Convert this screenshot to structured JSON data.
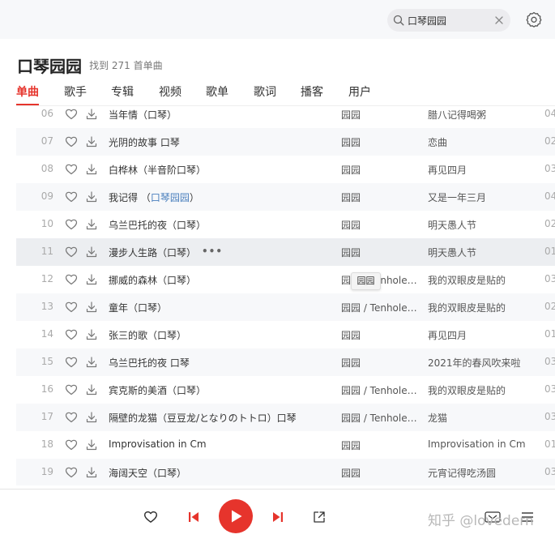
{
  "search": {
    "value": "口琴园园"
  },
  "header": {
    "title": "口琴园园",
    "found_text": "找到 271 首单曲"
  },
  "tabs": [
    {
      "label": "单曲"
    },
    {
      "label": "歌手"
    },
    {
      "label": "专辑"
    },
    {
      "label": "视频"
    },
    {
      "label": "歌单"
    },
    {
      "label": "歌词"
    },
    {
      "label": "播客"
    },
    {
      "label": "用户"
    }
  ],
  "songs": [
    {
      "num": "06",
      "name": "当年情（口琴）",
      "artist": "园园",
      "album": "腊八记得喝粥",
      "dur": "04"
    },
    {
      "num": "07",
      "name": "光阴的故事 口琴",
      "artist": "园园",
      "album": "恋曲",
      "dur": "02"
    },
    {
      "num": "08",
      "name": "白桦林（半音阶口琴）",
      "artist": "园园",
      "album": "再见四月",
      "dur": "03"
    },
    {
      "num": "09",
      "name_pre": "我记得 （",
      "name_hl": "口琴园园",
      "name_post": "）",
      "artist": "园园",
      "album": "又是一年三月",
      "dur": "04"
    },
    {
      "num": "10",
      "name": "乌兰巴托的夜（口琴）",
      "artist": "园园",
      "album": "明天愚人节",
      "dur": "02"
    },
    {
      "num": "11",
      "name": "漫步人生路（口琴）",
      "more": "•••",
      "artist": "园园",
      "album": "明天愚人节",
      "dur": "01"
    },
    {
      "num": "12",
      "name": "挪威的森林（口琴）",
      "artist": "园园 / Tenholes...",
      "album": "我的双眼皮是贴的",
      "dur": "03"
    },
    {
      "num": "13",
      "name": "童年（口琴）",
      "artist": "园园 / Tenholes...",
      "album": "我的双眼皮是贴的",
      "dur": "02"
    },
    {
      "num": "14",
      "name": "张三的歌（口琴）",
      "artist": "园园",
      "album": "再见四月",
      "dur": "01"
    },
    {
      "num": "15",
      "name": "乌兰巴托的夜 口琴",
      "artist": "园园",
      "album": "2021年的春风吹来啦",
      "dur": "03"
    },
    {
      "num": "16",
      "name": "宾克斯的美酒（口琴）",
      "artist": "园园 / Tenholes...",
      "album": "我的双眼皮是贴的",
      "dur": "03"
    },
    {
      "num": "17",
      "name": "隔壁的龙猫（豆豆龙/となりのトトロ）口琴",
      "artist": "园园 / Tenholes...",
      "album": "龙猫",
      "dur": "03"
    },
    {
      "num": "18",
      "name": "Improvisation in Cm",
      "artist": "园园",
      "album": "Improvisation in Cm",
      "dur": "01"
    },
    {
      "num": "19",
      "name": "海阔天空（口琴）",
      "artist": "园园",
      "album": "元宵记得吃汤圆",
      "dur": "03"
    }
  ],
  "tooltip": {
    "text": "园园"
  },
  "watermark": {
    "text": "知乎 @lovedern"
  },
  "colors": {
    "accent": "#e6342c",
    "link": "#4a7fbd"
  }
}
